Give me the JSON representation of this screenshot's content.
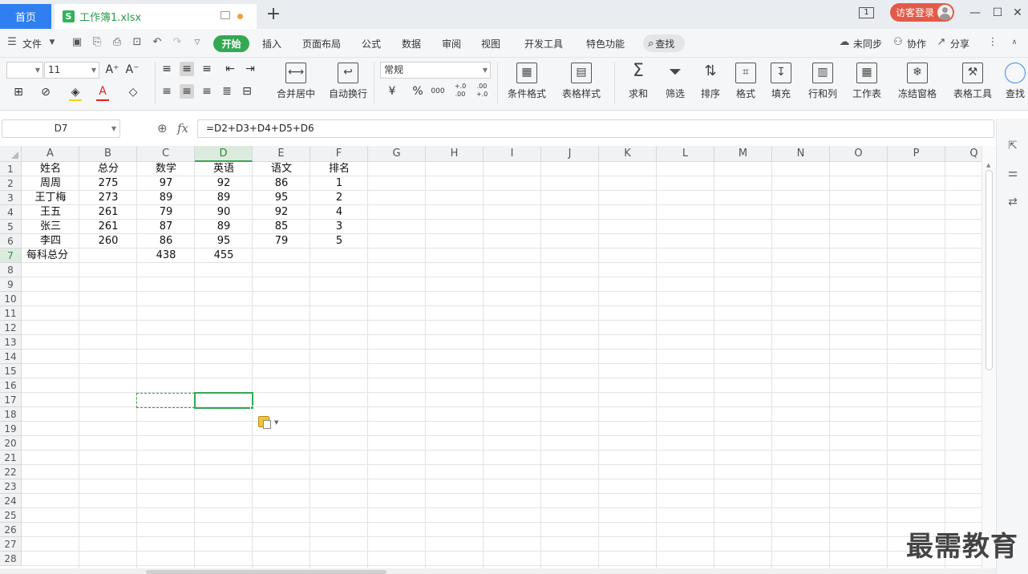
{
  "titlebar": {
    "home_tab": "首页",
    "doc_icon": "S",
    "doc_title": "工作簿1.xlsx",
    "new_tab": "+",
    "window_count": "1",
    "login": "访客登录",
    "minimize": "—",
    "maximize": "☐",
    "close": "✕"
  },
  "menubar": {
    "file": "文件",
    "items": [
      "开始",
      "插入",
      "页面布局",
      "公式",
      "数据",
      "审阅",
      "视图",
      "开发工具",
      "特色功能"
    ],
    "search": "查找",
    "right_items": [
      "未同步",
      "协作",
      "分享"
    ]
  },
  "ribbon": {
    "font_size": "11",
    "number_format": "常规",
    "merge_center": "合并居中",
    "wrap_text": "自动换行",
    "currency": "¥",
    "percent": "%",
    "thousands": "000",
    "inc_decimal": "+.0 .00",
    "dec_decimal": ".00 +.0",
    "cond_format": "条件格式",
    "table_style": "表格样式",
    "sum": "求和",
    "filter": "筛选",
    "sort": "排序",
    "format": "格式",
    "fill": "填充",
    "row_col": "行和列",
    "worksheet": "工作表",
    "freeze": "冻结窗格",
    "table_tools": "表格工具",
    "find": "查找"
  },
  "formula_bar": {
    "name_box": "D7",
    "fx": "fx",
    "formula": "=D2+D3+D4+D5+D6"
  },
  "sheet": {
    "columns": [
      "A",
      "B",
      "C",
      "D",
      "E",
      "F",
      "G",
      "H",
      "I",
      "J",
      "K",
      "L",
      "M",
      "N",
      "O",
      "P",
      "Q"
    ],
    "row_numbers": [
      "1",
      "2",
      "3",
      "4",
      "5",
      "6",
      "7",
      "8",
      "9",
      "10",
      "11",
      "12",
      "13",
      "14",
      "15",
      "16",
      "17",
      "18",
      "19",
      "20",
      "21",
      "22",
      "23",
      "24",
      "25",
      "26",
      "27",
      "28"
    ],
    "rows": [
      [
        "姓名",
        "总分",
        "数学",
        "英语",
        "语文",
        "排名"
      ],
      [
        "周周",
        "275",
        "97",
        "92",
        "86",
        "1"
      ],
      [
        "王丁梅",
        "273",
        "89",
        "89",
        "95",
        "2"
      ],
      [
        "王五",
        "261",
        "79",
        "90",
        "92",
        "4"
      ],
      [
        "张三",
        "261",
        "87",
        "89",
        "85",
        "3"
      ],
      [
        "李四",
        "260",
        "86",
        "95",
        "79",
        "5"
      ],
      [
        "每科总分",
        "",
        "438",
        "455",
        "",
        ""
      ]
    ],
    "active_cell": "D7",
    "copy_range": "C7"
  },
  "watermark": "最需教育"
}
